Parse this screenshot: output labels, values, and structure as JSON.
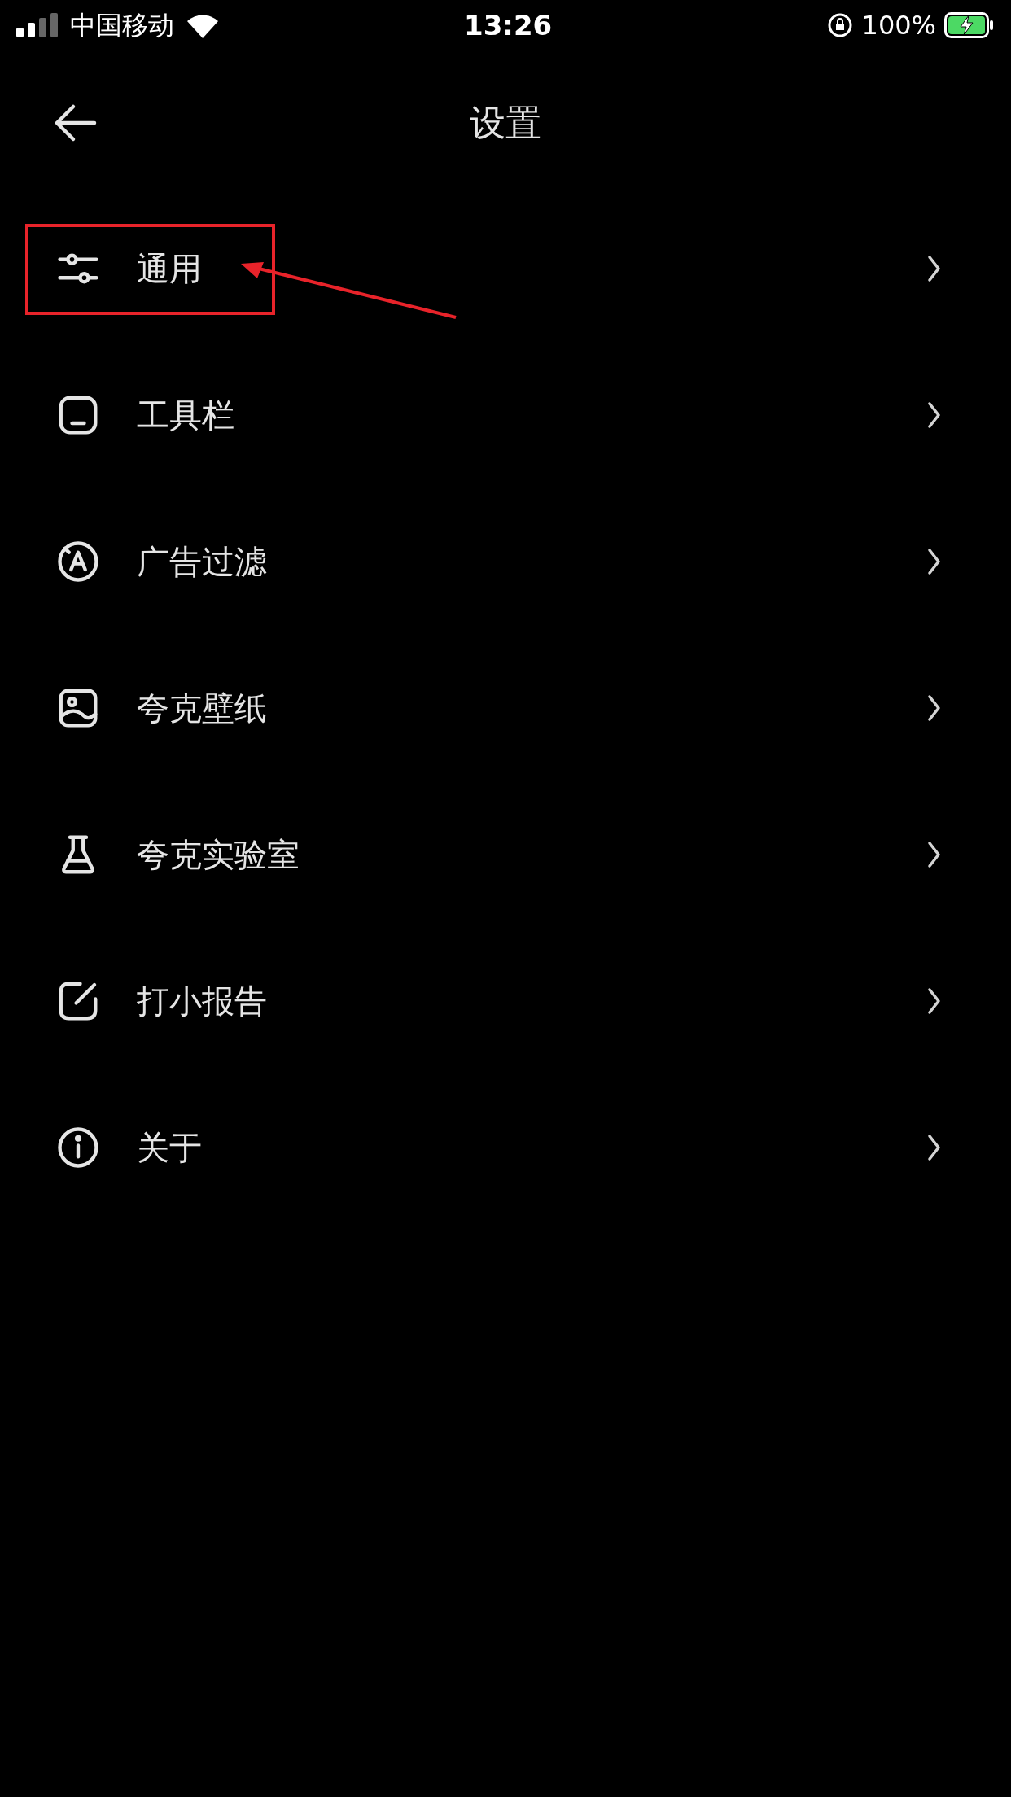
{
  "status_bar": {
    "carrier": "中国移动",
    "time": "13:26",
    "battery": "100%",
    "charging": true
  },
  "header": {
    "title": "设置"
  },
  "menu": [
    {
      "label": "通用",
      "kind": "sliders",
      "highlighted": true
    },
    {
      "label": "工具栏",
      "kind": "toolbar",
      "highlighted": false
    },
    {
      "label": "广告过滤",
      "kind": "adblock",
      "highlighted": false
    },
    {
      "label": "夸克壁纸",
      "kind": "wallpaper",
      "highlighted": false
    },
    {
      "label": "夸克实验室",
      "kind": "lab",
      "highlighted": false
    },
    {
      "label": "打小报告",
      "kind": "feedback",
      "highlighted": false
    },
    {
      "label": "关于",
      "kind": "about",
      "highlighted": false
    }
  ]
}
